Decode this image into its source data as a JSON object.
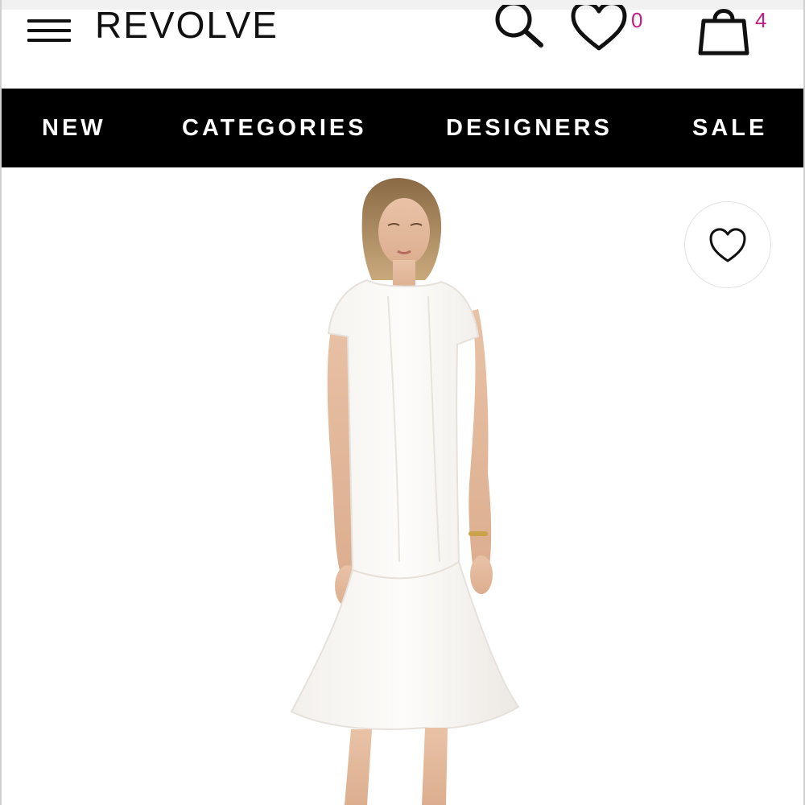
{
  "header": {
    "logo": "REVOLVE",
    "wishlist_count": "0",
    "bag_count": "4"
  },
  "nav": {
    "items": [
      {
        "label": "NEW"
      },
      {
        "label": "CATEGORIES"
      },
      {
        "label": "DESIGNERS"
      },
      {
        "label": "SALE"
      }
    ]
  },
  "product": {
    "image_alt": "",
    "dress_color": "#fbf9f6"
  },
  "colors": {
    "accent": "#c21d84",
    "nav_bg": "#000000",
    "text": "#111111"
  },
  "icons": {
    "menu": "hamburger-icon",
    "search": "search-icon",
    "wishlist": "heart-icon",
    "bag": "shopping-bag-icon",
    "favorite": "heart-icon"
  }
}
